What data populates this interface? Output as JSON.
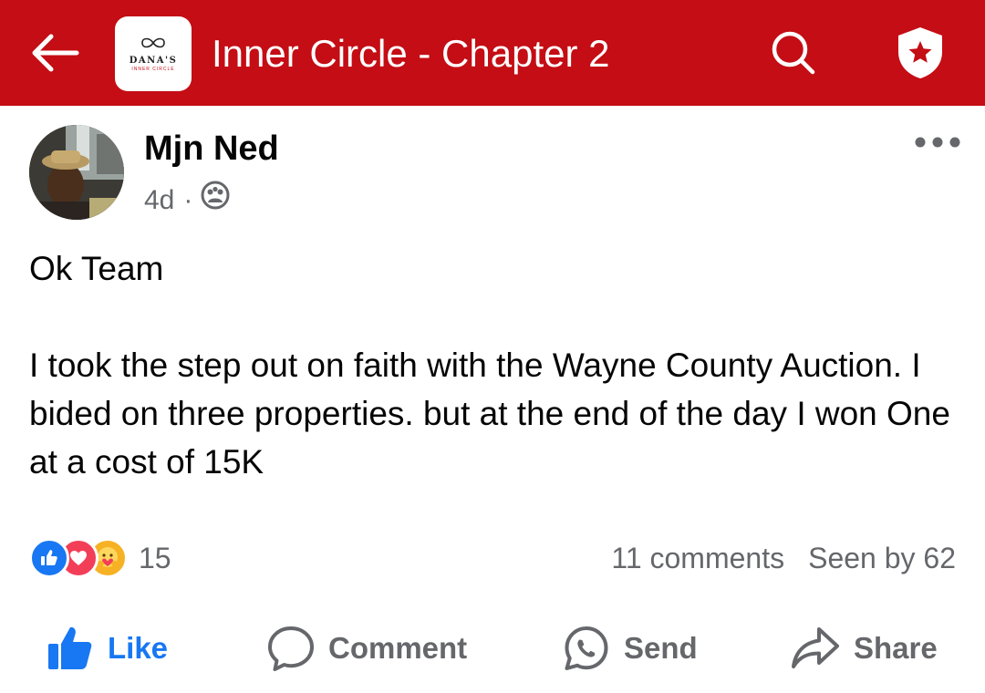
{
  "colors": {
    "header_bg": "#c40d14",
    "like_blue": "#1877f2",
    "love_red": "#f33e58",
    "care_yellow": "#f7b125",
    "muted_text": "#65676b"
  },
  "header": {
    "back_icon": "arrow-left-icon",
    "group_logo": {
      "brand": "DANA'S",
      "subtitle": "INNER CIRCLE"
    },
    "title": "Inner Circle - Chapter 2",
    "search_icon": "search-icon",
    "admin_icon": "admin-shield-star-icon"
  },
  "post": {
    "author": "Mjn Ned",
    "time": "4d",
    "separator": "·",
    "audience_icon": "group-audience-icon",
    "more_icon": "more-horizontal-icon",
    "body": [
      "Ok Team",
      "I took the step out on faith with the Wayne County Auction.  I bided on three properties.  but at the end of the day I won One at a cost of 15K"
    ]
  },
  "stats": {
    "reaction_icons": [
      "like-reaction-icon",
      "love-reaction-icon",
      "care-reaction-icon"
    ],
    "reaction_count": "15",
    "comments": "11 comments",
    "seen_by": "Seen by 62"
  },
  "actions": {
    "like": "Like",
    "comment": "Comment",
    "send": "Send",
    "share": "Share"
  }
}
